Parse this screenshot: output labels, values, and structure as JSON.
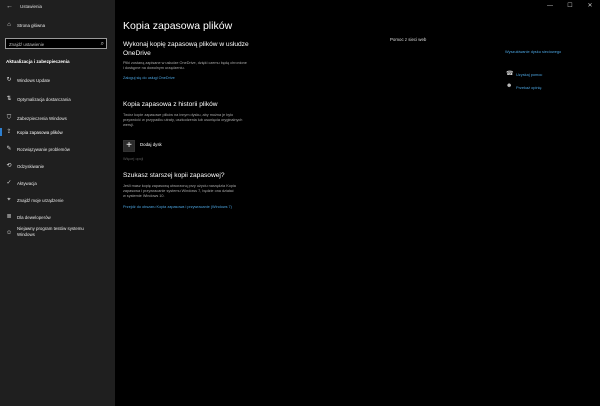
{
  "window": {
    "title": "Ustawienia",
    "back_glyph": "←",
    "controls": [
      "—",
      "☐",
      "✕"
    ]
  },
  "sidebar": {
    "home": "Strona główna",
    "search_placeholder": "Znajdź ustawienie",
    "category": "Aktualizacja i zabezpieczenia",
    "items": [
      {
        "label": "Windows Update",
        "icon": "↻"
      },
      {
        "label": "Optymalizacja dostarczania",
        "icon": "⇅"
      },
      {
        "label": "Zabezpieczenia Windows",
        "icon": "⛉"
      },
      {
        "label": "Kopia zapasowa plików",
        "icon": "⇪"
      },
      {
        "label": "Rozwiązywanie problemów",
        "icon": "✎"
      },
      {
        "label": "Odzyskiwanie",
        "icon": "⟲"
      },
      {
        "label": "Aktywacja",
        "icon": "✓"
      },
      {
        "label": "Znajdź moje urządzenie",
        "icon": "⌖"
      },
      {
        "label": "Dla deweloperów",
        "icon": "≣"
      },
      {
        "label": "Niejawny program testów systemu",
        "label2": "Windows",
        "icon": "☺"
      }
    ]
  },
  "main": {
    "title": "Kopia zapasowa plików",
    "onedrive": {
      "heading1": "Wykonaj kopię zapasową plików w usłudze",
      "heading2": "OneDrive",
      "desc1": "Pliki zostaną zapisane w usłudze OneDrive, dzięki czemu będą chronione",
      "desc2": "i dostępne na dowolnym urządzeniu.",
      "link": "Zaloguj się do usługi OneDrive"
    },
    "history": {
      "heading": "Kopia zapasowa z historii plików",
      "desc1": "Twórz kopie zapasowe plików na innym dysku, aby można je było",
      "desc2": "przywrócić w przypadku utraty, uszkodzenia lub usunięcia oryginalnych",
      "desc3": "wersji.",
      "add_label": "Dodaj dysk",
      "more": "Więcej opcji"
    },
    "older": {
      "heading": "Szukasz starszej kopii zapasowej?",
      "desc1": "Jeśli masz kopię zapasową utworzoną przy użyciu narzędzia Kopia",
      "desc2": "zapasowa i przywracanie systemu Windows 7, będzie ona działać",
      "desc3": "w systemie Windows 10.",
      "link": "Przejdź do obszaru Kopia zapasowa i przywracanie (Windows 7)"
    }
  },
  "right_panel": {
    "title": "Pomoc z sieci web",
    "link": "Wyszukiwanie dysku sieciowego",
    "help": "Uzyskaj pomoc",
    "feedback": "Przekaż opinię"
  }
}
